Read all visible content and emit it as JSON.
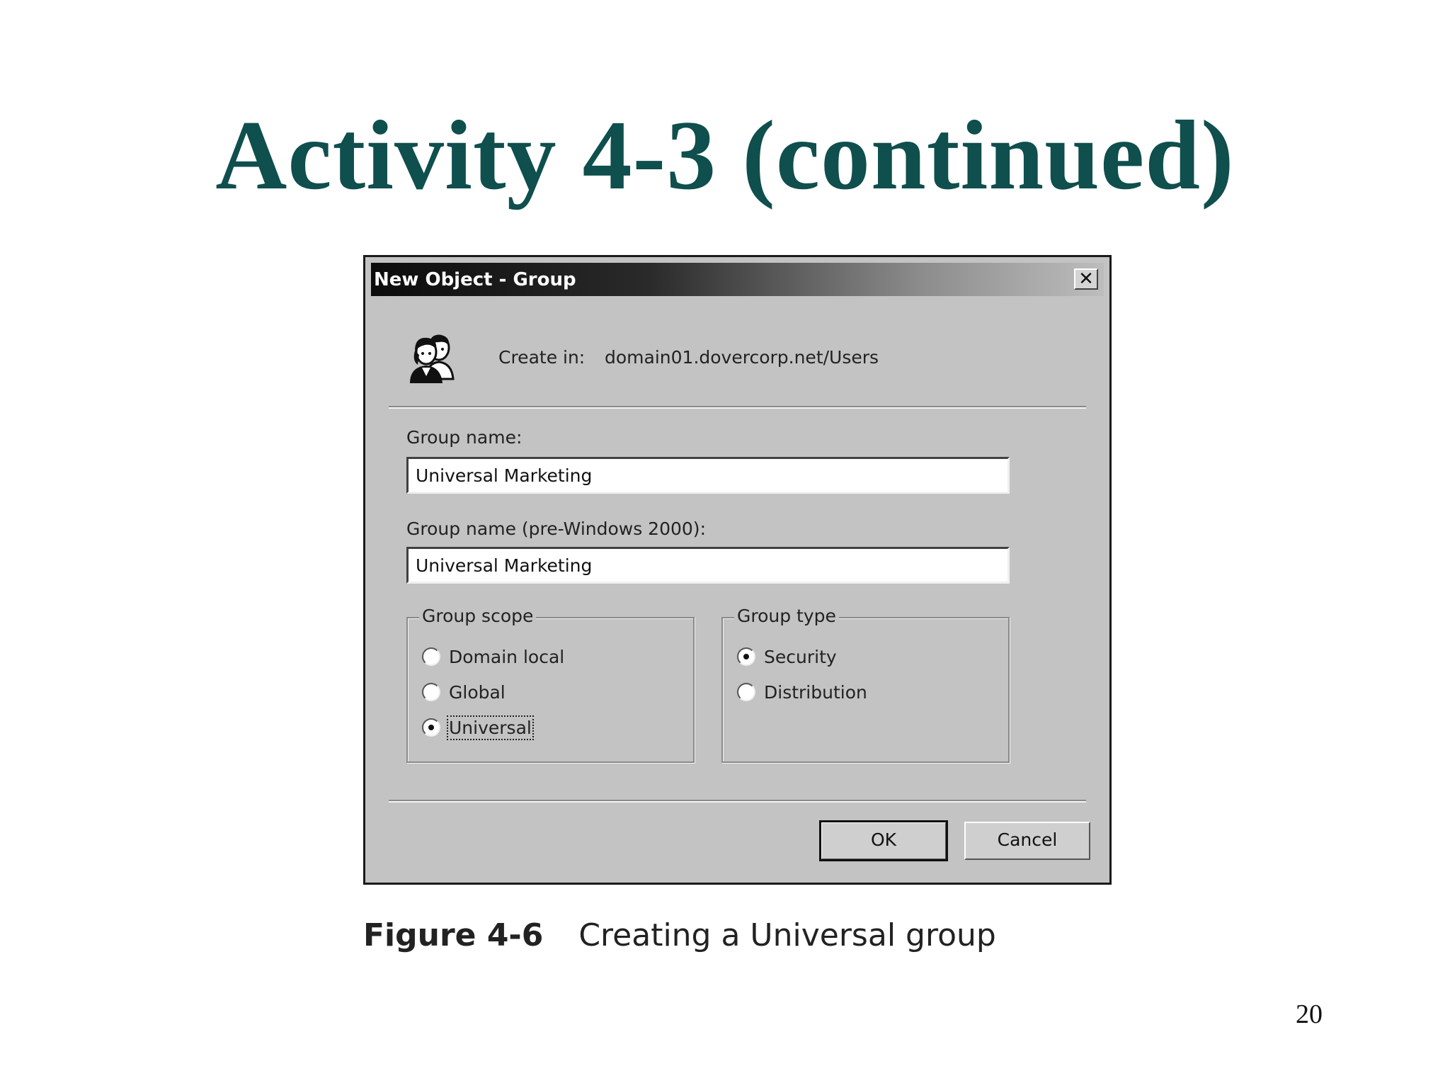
{
  "slide": {
    "title": "Activity 4-3 (continued)",
    "page_number": "20"
  },
  "dialog": {
    "title": "New Object - Group",
    "close_glyph": "✕",
    "create_in_label": "Create in:",
    "create_in_value": "domain01.dovercorp.net/Users",
    "group_name_label": "Group name:",
    "group_name_value": "Universal Marketing",
    "pre2000_label": "Group name (pre-Windows 2000):",
    "pre2000_value": "Universal Marketing",
    "group_scope": {
      "legend": "Group scope",
      "options": [
        {
          "label": "Domain local",
          "checked": false
        },
        {
          "label": "Global",
          "checked": false
        },
        {
          "label": "Universal",
          "checked": true
        }
      ]
    },
    "group_type": {
      "legend": "Group type",
      "options": [
        {
          "label": "Security",
          "checked": true
        },
        {
          "label": "Distribution",
          "checked": false
        }
      ]
    },
    "ok_label": "OK",
    "cancel_label": "Cancel"
  },
  "caption": {
    "figure": "Figure 4-6",
    "text": "Creating a Universal group"
  },
  "icons": {
    "group": "users-group-icon",
    "close": "close-icon"
  }
}
